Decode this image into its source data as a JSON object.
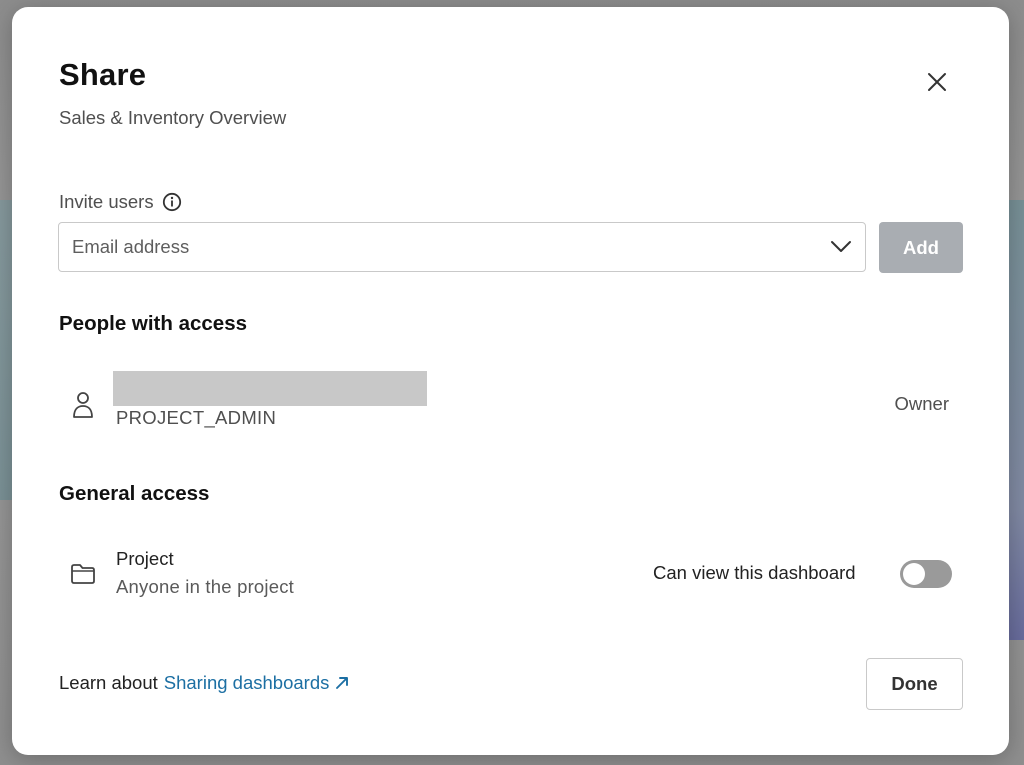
{
  "dialog": {
    "title": "Share",
    "subtitle": "Sales & Inventory Overview",
    "close_icon": "close-icon"
  },
  "invite": {
    "label": "Invite users",
    "info_icon": "info-icon",
    "email_placeholder": "Email address",
    "email_value": "",
    "dropdown_icon": "chevron-down-icon",
    "add_label": "Add"
  },
  "people": {
    "section_title": "People with access",
    "items": [
      {
        "icon": "user-icon",
        "name_redacted": true,
        "role": "PROJECT_ADMIN",
        "permission": "Owner"
      }
    ]
  },
  "general": {
    "section_title": "General access",
    "icon": "folder-icon",
    "name": "Project",
    "description": "Anyone in the project",
    "toggle_label": "Can view this dashboard",
    "toggle_on": false
  },
  "footer": {
    "learn_prefix": "Learn about",
    "link_text": "Sharing dashboards",
    "link_icon": "external-link-icon",
    "done_label": "Done"
  },
  "colors": {
    "link": "#1c6fa3",
    "add_button_disabled": "#a9adb2",
    "toggle_off": "#9a9a9a"
  }
}
